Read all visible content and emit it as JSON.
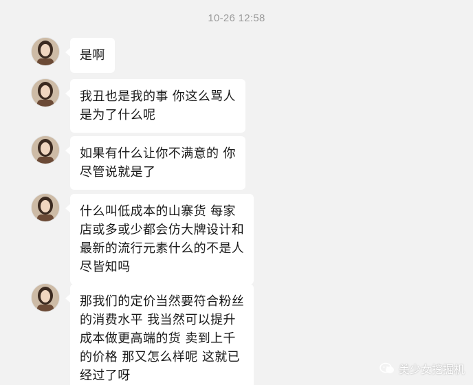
{
  "timestamp": "10-26 12:58",
  "messages": [
    {
      "text": "是啊"
    },
    {
      "text": "我丑也是我的事 你这么骂人\n是为了什么呢"
    },
    {
      "text": "如果有什么让你不满意的 你\n尽管说就是了"
    },
    {
      "text": "什么叫低成本的山寨货 每家\n店或多或少都会仿大牌设计和\n最新的流行元素什么的不是人\n尽皆知吗"
    },
    {
      "text": "那我们的定价当然要符合粉丝\n的消费水平 我当然可以提升\n成本做更高端的货 卖到上千\n的价格 那又怎么样呢 这就已\n经过了呀"
    }
  ],
  "watermark": {
    "text": "美少女挖掘机",
    "icon": "wechat-bubble-icon"
  },
  "colors": {
    "background": "#f2f2f2",
    "bubble": "#ffffff",
    "timestamp": "#9b9b9b",
    "text": "#1a1a1a"
  }
}
